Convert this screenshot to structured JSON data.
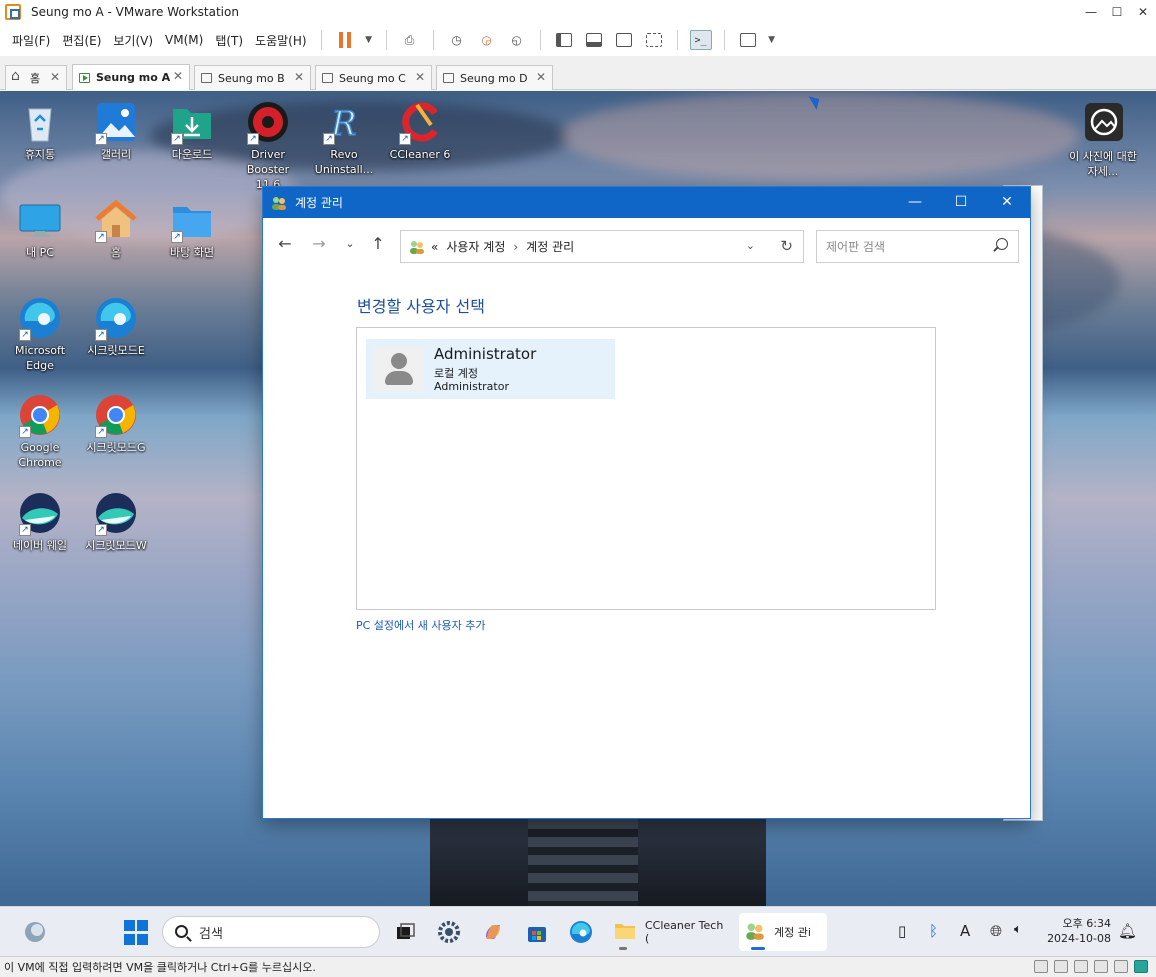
{
  "vmware": {
    "title": "Seung mo A - VMware Workstation",
    "menus": [
      "파일(F)",
      "편집(E)",
      "보기(V)",
      "VM(M)",
      "탭(T)",
      "도움말(H)"
    ],
    "tabs": [
      {
        "label": "홈",
        "icon": "home-icon"
      },
      {
        "label": "Seung mo A",
        "icon": "vm-running-icon",
        "active": true
      },
      {
        "label": "Seung mo B",
        "icon": "vm-icon"
      },
      {
        "label": "Seung mo C",
        "icon": "vm-icon"
      },
      {
        "label": "Seung mo D",
        "icon": "vm-icon"
      }
    ],
    "status_text": "이 VM에 직접 입력하려면 VM을 클릭하거나 Ctrl+G를 누르십시오.",
    "colors": {
      "pause": "#e8762c",
      "accent": "#1e5bb8"
    }
  },
  "desktop": {
    "icons": [
      {
        "label": "휴지통",
        "icon": "recycle-bin-icon"
      },
      {
        "label": "갤러리",
        "icon": "gallery-icon"
      },
      {
        "label": "다운로드",
        "icon": "download-folder-icon"
      },
      {
        "label": "Driver Booster 11.6",
        "icon": "driver-booster-icon"
      },
      {
        "label": "Revo Uninstall...",
        "icon": "revo-uninstaller-icon"
      },
      {
        "label": "CCleaner 6",
        "icon": "ccleaner-icon"
      },
      {
        "label": "내 PC",
        "icon": "monitor-icon"
      },
      {
        "label": "홈",
        "icon": "home-folder-icon"
      },
      {
        "label": "바탕 화면",
        "icon": "desktop-folder-icon"
      },
      {
        "label": "Microsoft Edge",
        "icon": "edge-icon"
      },
      {
        "label": "시크릿모드E",
        "icon": "edge-icon"
      },
      {
        "label": "Google Chrome",
        "icon": "chrome-icon"
      },
      {
        "label": "시크릿모드G",
        "icon": "chrome-icon"
      },
      {
        "label": "네이버 웨일",
        "icon": "whale-icon"
      },
      {
        "label": "시크릿모드W",
        "icon": "whale-icon"
      },
      {
        "label": "이 사진에 대한 자세...",
        "icon": "photo-info-icon"
      }
    ]
  },
  "account_window": {
    "title": "계정 관리",
    "breadcrumb": {
      "prefix": "«",
      "items": [
        "사용자 계정",
        "계정 관리"
      ]
    },
    "search_placeholder": "제어판 검색",
    "heading": "변경할 사용자 선택",
    "user": {
      "name": "Administrator",
      "type": "로컬 계정",
      "group": "Administrator"
    },
    "add_link": "PC 설정에서 새 사용자 추가"
  },
  "taskbar": {
    "search_placeholder": "검색",
    "apps": [
      {
        "label": "CCleaner Tech (",
        "icon": "folder-icon"
      },
      {
        "label": "계정 관i",
        "icon": "user-accounts-icon",
        "active": true
      }
    ],
    "time": "오후 6:34",
    "date": "2024-10-08"
  }
}
